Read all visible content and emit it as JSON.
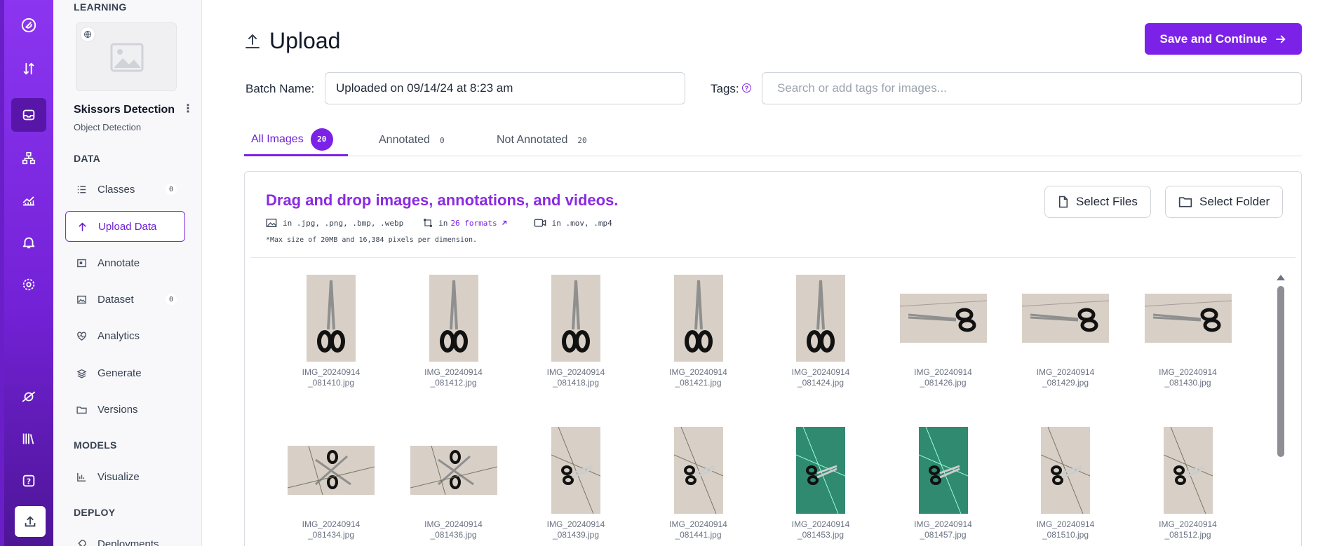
{
  "rail": {
    "icons": [
      "logo-icon",
      "sort-icon",
      "inbox-icon",
      "workflow-icon",
      "chart-icon",
      "bell-icon",
      "gear-icon",
      "planet-icon",
      "library-icon",
      "help-icon",
      "upload-icon"
    ]
  },
  "sidebar": {
    "section_learning": "LEARNING",
    "project_name": "Skissors Detection",
    "project_type": "Object Detection",
    "section_data": "DATA",
    "section_models": "MODELS",
    "section_deploy": "DEPLOY",
    "items": [
      {
        "label": "Classes",
        "badge": "0"
      },
      {
        "label": "Upload Data"
      },
      {
        "label": "Annotate"
      },
      {
        "label": "Dataset",
        "badge": "0"
      },
      {
        "label": "Analytics"
      },
      {
        "label": "Generate"
      },
      {
        "label": "Versions"
      },
      {
        "label": "Visualize"
      },
      {
        "label": "Deployments"
      }
    ]
  },
  "header": {
    "title": "Upload",
    "save_label": "Save and Continue"
  },
  "form": {
    "batch_label": "Batch Name:",
    "batch_value": "Uploaded on 09/14/24 at 8:23 am",
    "tags_label": "Tags:",
    "tags_help": "?",
    "tags_placeholder": "Search or add tags for images..."
  },
  "tabs": [
    {
      "label": "All Images",
      "count": "20"
    },
    {
      "label": "Annotated",
      "count": "0"
    },
    {
      "label": "Not Annotated",
      "count": "20"
    }
  ],
  "dropzone": {
    "title": "Drag and drop images, annotations, and videos.",
    "image_formats": "in .jpg, .png, .bmp, .webp",
    "annot_prefix": "in",
    "annot_link": "26 formats",
    "video_formats": "in .mov, .mp4",
    "note": "*Max size of 20MB and 16,384 pixels per dimension.",
    "select_files": "Select Files",
    "select_folder": "Select Folder"
  },
  "images": [
    {
      "l1": "IMG_20240914",
      "l2": "_081410.jpg"
    },
    {
      "l1": "IMG_20240914",
      "l2": "_081412.jpg"
    },
    {
      "l1": "IMG_20240914",
      "l2": "_081418.jpg"
    },
    {
      "l1": "IMG_20240914",
      "l2": "_081421.jpg"
    },
    {
      "l1": "IMG_20240914",
      "l2": "_081424.jpg"
    },
    {
      "l1": "IMG_20240914",
      "l2": "_081426.jpg"
    },
    {
      "l1": "IMG_20240914",
      "l2": "_081429.jpg"
    },
    {
      "l1": "IMG_20240914",
      "l2": "_081430.jpg"
    },
    {
      "l1": "IMG_20240914",
      "l2": "_081434.jpg"
    },
    {
      "l1": "IMG_20240914",
      "l2": "_081436.jpg"
    },
    {
      "l1": "IMG_20240914",
      "l2": "_081439.jpg"
    },
    {
      "l1": "IMG_20240914",
      "l2": "_081441.jpg"
    },
    {
      "l1": "IMG_20240914",
      "l2": "_081453.jpg"
    },
    {
      "l1": "IMG_20240914",
      "l2": "_081457.jpg"
    },
    {
      "l1": "IMG_20240914",
      "l2": "_081510.jpg"
    },
    {
      "l1": "IMG_20240914",
      "l2": "_081512.jpg"
    }
  ],
  "colors": {
    "accent": "#7c22e8",
    "rail_top": "#8b35f0",
    "rail_bottom": "#4d1596"
  }
}
